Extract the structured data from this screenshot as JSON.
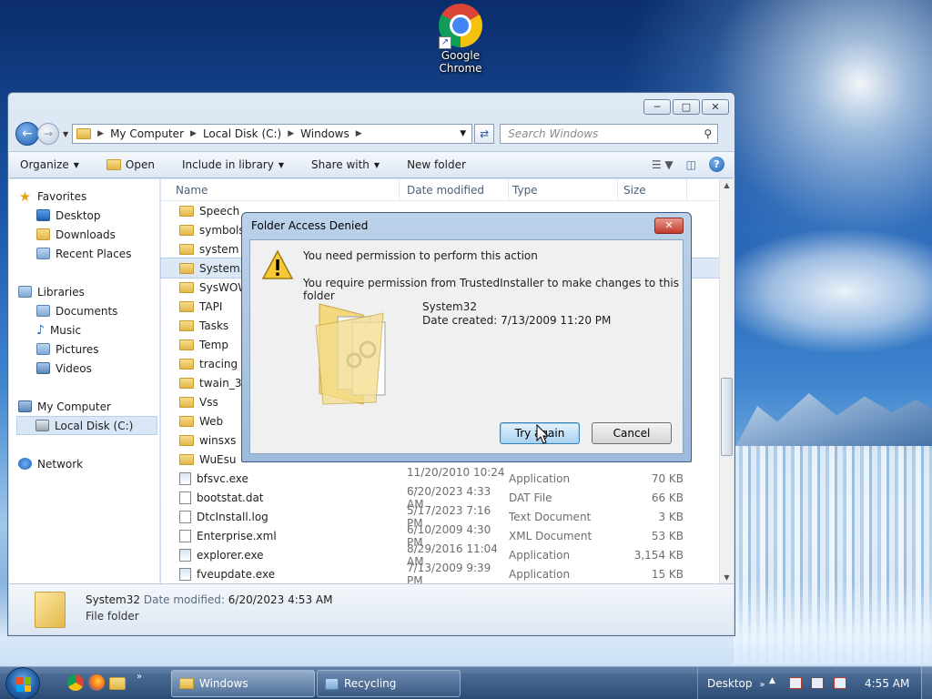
{
  "desktop": {
    "icon_label_line1": "Google",
    "icon_label_line2": "Chrome"
  },
  "explorer": {
    "breadcrumb": [
      "My Computer",
      "Local Disk (C:)",
      "Windows"
    ],
    "search_placeholder": "Search Windows",
    "toolbar": {
      "organize": "Organize",
      "open": "Open",
      "include": "Include in library",
      "share": "Share with",
      "new_folder": "New folder"
    },
    "nav": {
      "favorites": "Favorites",
      "desktop": "Desktop",
      "downloads": "Downloads",
      "recent": "Recent Places",
      "libraries": "Libraries",
      "documents": "Documents",
      "music": "Music",
      "pictures": "Pictures",
      "videos": "Videos",
      "computer": "My Computer",
      "local_disk": "Local Disk (C:)",
      "network": "Network"
    },
    "columns": {
      "name": "Name",
      "date": "Date modified",
      "type": "Type",
      "size": "Size"
    },
    "folders": [
      {
        "name": "Speech"
      },
      {
        "name": "symbols"
      },
      {
        "name": "system"
      },
      {
        "name": "System32"
      },
      {
        "name": "SysWOW64"
      },
      {
        "name": "TAPI"
      },
      {
        "name": "Tasks"
      },
      {
        "name": "Temp"
      },
      {
        "name": "tracing"
      },
      {
        "name": "twain_32"
      },
      {
        "name": "Vss"
      },
      {
        "name": "Web"
      },
      {
        "name": "winsxs"
      },
      {
        "name": "WuEsu"
      }
    ],
    "files": [
      {
        "name": "bfsvc.exe",
        "date": "11/20/2010 10:24 ...",
        "type": "Application",
        "size": "70 KB"
      },
      {
        "name": "bootstat.dat",
        "date": "6/20/2023 4:33 AM",
        "type": "DAT File",
        "size": "66 KB"
      },
      {
        "name": "DtcInstall.log",
        "date": "5/17/2023 7:16 PM",
        "type": "Text Document",
        "size": "3 KB"
      },
      {
        "name": "Enterprise.xml",
        "date": "6/10/2009 4:30 PM",
        "type": "XML Document",
        "size": "53 KB"
      },
      {
        "name": "explorer.exe",
        "date": "8/29/2016 11:04 AM",
        "type": "Application",
        "size": "3,154 KB"
      },
      {
        "name": "fveupdate.exe",
        "date": "7/13/2009 9:39 PM",
        "type": "Application",
        "size": "15 KB"
      }
    ],
    "details": {
      "name": "System32",
      "date_label": "Date modified:",
      "date_value": "6/20/2023 4:53 AM",
      "type": "File folder"
    }
  },
  "dialog": {
    "title": "Folder Access Denied",
    "message1": "You need permission to perform this action",
    "message2": "You require permission from TrustedInstaller to make changes to this folder",
    "folder_name": "System32",
    "date_created": "Date created: 7/13/2009 11:20 PM",
    "try_again": "Try again",
    "cancel": "Cancel"
  },
  "taskbar": {
    "windows_label": "Windows",
    "recycling_label": "Recycling",
    "desktop_label": "Desktop",
    "time": "4:55 AM"
  }
}
